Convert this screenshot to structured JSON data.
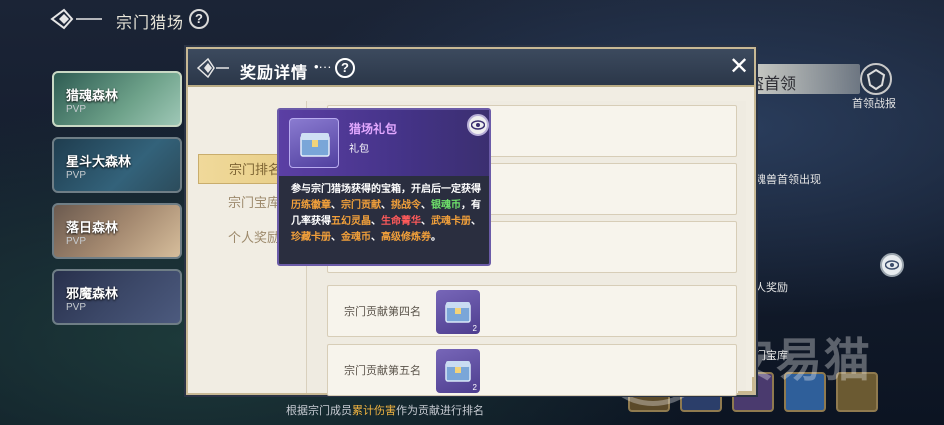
{
  "header": {
    "title": "宗门猎场",
    "help": "?"
  },
  "maps": [
    {
      "name": "猎魂森林",
      "tag": "PVP"
    },
    {
      "name": "星斗大森林",
      "tag": "PVP"
    },
    {
      "name": "落日森林",
      "tag": "PVP"
    },
    {
      "name": "邪魔森林",
      "tag": "PVP"
    }
  ],
  "right_panel": {
    "boss_title": "盗首领",
    "boss_report": "首领战报",
    "boss_appear": "魂兽首领出现",
    "reward_label": "人奖励",
    "treasure_label": "门宝库"
  },
  "bottom_note": {
    "prefix": "根据宗门成员",
    "highlight": "累计伤害",
    "suffix": "作为贡献进行排名"
  },
  "watermark": "安易猫",
  "modal": {
    "title": "奖励详情",
    "dots": "•···",
    "help": "?",
    "close": "✕",
    "tabs": [
      "宗门排名",
      "宗门宝库",
      "个人奖励"
    ],
    "rows": [
      {
        "label": "",
        "count": ""
      },
      {
        "label": "",
        "count": ""
      },
      {
        "label": "",
        "count": ""
      },
      {
        "label": "宗门贡献第四名",
        "count": "2"
      },
      {
        "label": "宗门贡献第五名",
        "count": "2"
      }
    ]
  },
  "tooltip": {
    "name": "猎场礼包",
    "type": "礼包",
    "desc": [
      {
        "t": "参与宗门猎场获得的宝箱，开启后一定获得",
        "c": ""
      },
      {
        "t": "历练徽章",
        "c": "or"
      },
      {
        "t": "、",
        "c": ""
      },
      {
        "t": "宗门贡献",
        "c": "or"
      },
      {
        "t": "、",
        "c": ""
      },
      {
        "t": "挑战令",
        "c": "or"
      },
      {
        "t": "、",
        "c": ""
      },
      {
        "t": "银魂币",
        "c": "gr"
      },
      {
        "t": "，有几率获得",
        "c": ""
      },
      {
        "t": "五幻灵晶",
        "c": "or"
      },
      {
        "t": "、",
        "c": ""
      },
      {
        "t": "生命菁华",
        "c": "rd"
      },
      {
        "t": "、",
        "c": ""
      },
      {
        "t": "武魂卡册",
        "c": "or"
      },
      {
        "t": "、",
        "c": ""
      },
      {
        "t": "珍藏卡册",
        "c": "or"
      },
      {
        "t": "、",
        "c": ""
      },
      {
        "t": "金魂币",
        "c": "or"
      },
      {
        "t": "、",
        "c": ""
      },
      {
        "t": "高级修炼券",
        "c": "or"
      },
      {
        "t": "。",
        "c": ""
      }
    ]
  },
  "colors": {
    "accent_gold": "#e7cd86",
    "tooltip_purple": "#5b3fa4",
    "highlight_orange": "#f2a03a",
    "highlight_green": "#6fe36b",
    "highlight_red": "#ff5a5a"
  }
}
